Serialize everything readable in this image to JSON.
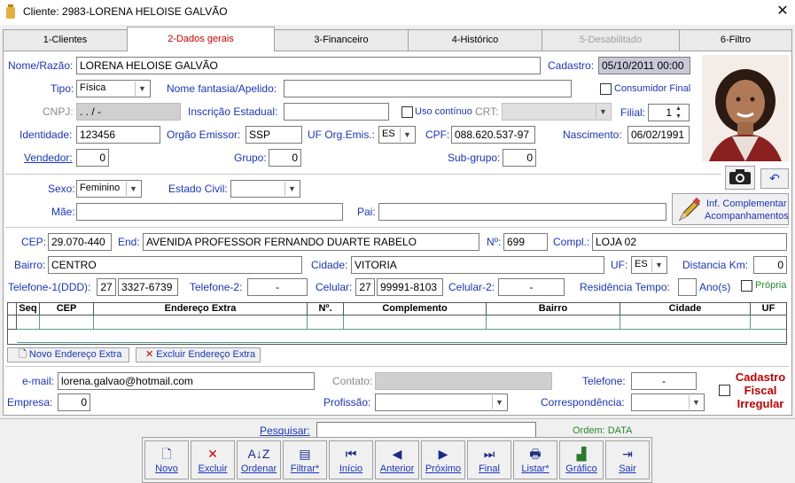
{
  "window": {
    "title": "Cliente: 2983-LORENA HELOISE GALVÃO",
    "close": "✕"
  },
  "tabs": [
    {
      "label": "1-Clientes",
      "state": "normal"
    },
    {
      "label": "2-Dados gerais",
      "state": "active"
    },
    {
      "label": "3-Financeiro",
      "state": "normal"
    },
    {
      "label": "4-Histórico",
      "state": "normal"
    },
    {
      "label": "5-Desabilitado",
      "state": "disabled"
    },
    {
      "label": "6-Filtro",
      "state": "normal"
    }
  ],
  "form": {
    "nome_label": "Nome/Razão:",
    "nome": "LORENA HELOISE GALVÃO",
    "cadastro_label": "Cadastro:",
    "cadastro": "05/10/2011 00:00",
    "tipo_label": "Tipo:",
    "tipo": "Física",
    "fantasia_label": "Nome fantasia/Apelido:",
    "fantasia": "",
    "consumidor_label": "Consumidor Final",
    "cnpj_label": "CNPJ:",
    "cnpj": "   .   .   /   -",
    "ie_label": "Inscrição Estadual:",
    "ie": "",
    "uso_label": "Uso contínuo",
    "crt_label": "CRT:",
    "filial_label": "Filial:",
    "filial": "1",
    "identidade_label": "Identidade:",
    "identidade": "123456",
    "orgao_label": "Orgão Emissor:",
    "orgao": "SSP",
    "uforg_label": "UF Org.Emis.:",
    "uforg": "ES",
    "cpf_label": "CPF:",
    "cpf": "088.620.537-97",
    "nasc_label": "Nascimento:",
    "nasc": "06/02/1991",
    "vendedor_label": "Vendedor:",
    "vendedor": "0",
    "grupo_label": "Grupo:",
    "grupo": "0",
    "subgrupo_label": "Sub-grupo:",
    "subgrupo": "0",
    "sexo_label": "Sexo:",
    "sexo": "Feminino",
    "civil_label": "Estado Civil:",
    "civil": "",
    "mae_label": "Mãe:",
    "mae": "",
    "pai_label": "Pai:",
    "pai": "",
    "inf_label1": "Inf. Complementar",
    "inf_label2": "Acompanhamentos",
    "cep_label": "CEP:",
    "cep": "29.070-440",
    "end_label": "End:",
    "end": "AVENIDA PROFESSOR FERNANDO DUARTE RABELO",
    "num_label": "Nº:",
    "num": "699",
    "compl_label": "Compl.:",
    "compl": "LOJA 02",
    "bairro_label": "Bairro:",
    "bairro": "CENTRO",
    "cidade_label": "Cidade:",
    "cidade": "VITORIA",
    "uf_label": "UF:",
    "uf": "ES",
    "dist_label": "Distancia Km:",
    "dist": "0",
    "tel1_label": "Telefone-1(DDD):",
    "tel1_ddd": "27",
    "tel1": "3327-6739",
    "tel2_label": "Telefone-2:",
    "tel2": "-",
    "cel_label": "Celular:",
    "cel_ddd": "27",
    "cel": "99991-8103",
    "cel2_label": "Celular-2:",
    "cel2": "-",
    "res_label": "Residência Tempo:",
    "res": "",
    "anos_label": "Ano(s)",
    "propria_label": "Própria",
    "email_label": "e-mail:",
    "email": "lorena.galvao@hotmail.com",
    "contato_label": "Contato:",
    "contato": "",
    "telefone_label": "Telefone:",
    "telefone": "-",
    "empresa_label": "Empresa:",
    "empresa": "0",
    "prof_label": "Profissão:",
    "prof": "",
    "corr_label": "Correspondência:",
    "corr": "",
    "irreg_label": "Cadastro Fiscal Irregular"
  },
  "grid": {
    "columns": [
      "Seq",
      "CEP",
      "Endereço Extra",
      "Nº.",
      "Complemento",
      "Bairro",
      "Cidade",
      "UF"
    ]
  },
  "buttons": {
    "novo_end": "Novo Endereço Extra",
    "excluir_end": "Excluir Endereço Extra"
  },
  "bottom": {
    "pesquisar_label": "Pesquisar:",
    "pesquisar": "",
    "ordem": "Ordem: DATA",
    "toolbar": [
      {
        "label": "Novo",
        "icon": "new-doc-icon",
        "glyph": "🗋"
      },
      {
        "label": "Excluir",
        "icon": "delete-x-icon",
        "glyph": "✕"
      },
      {
        "label": "Ordenar",
        "icon": "sort-az-icon",
        "glyph": "A↓Z"
      },
      {
        "label": "Filtrar*",
        "icon": "filter-icon",
        "glyph": "▤"
      },
      {
        "label": "Início",
        "icon": "first-record-icon",
        "glyph": "⏮"
      },
      {
        "label": "Anterior",
        "icon": "previous-icon",
        "glyph": "◀"
      },
      {
        "label": "Próximo",
        "icon": "next-icon",
        "glyph": "▶"
      },
      {
        "label": "Final",
        "icon": "last-record-icon",
        "glyph": "⏭"
      },
      {
        "label": "Listar*",
        "icon": "printer-icon",
        "glyph": "🖶"
      },
      {
        "label": "Gráfico",
        "icon": "bar-chart-icon",
        "glyph": "▟"
      },
      {
        "label": "Sair",
        "icon": "exit-door-icon",
        "glyph": "⇥"
      }
    ]
  },
  "colors": {
    "label": "#1a35c0",
    "active_tab": "#d00000",
    "irregular": "#c00000"
  }
}
